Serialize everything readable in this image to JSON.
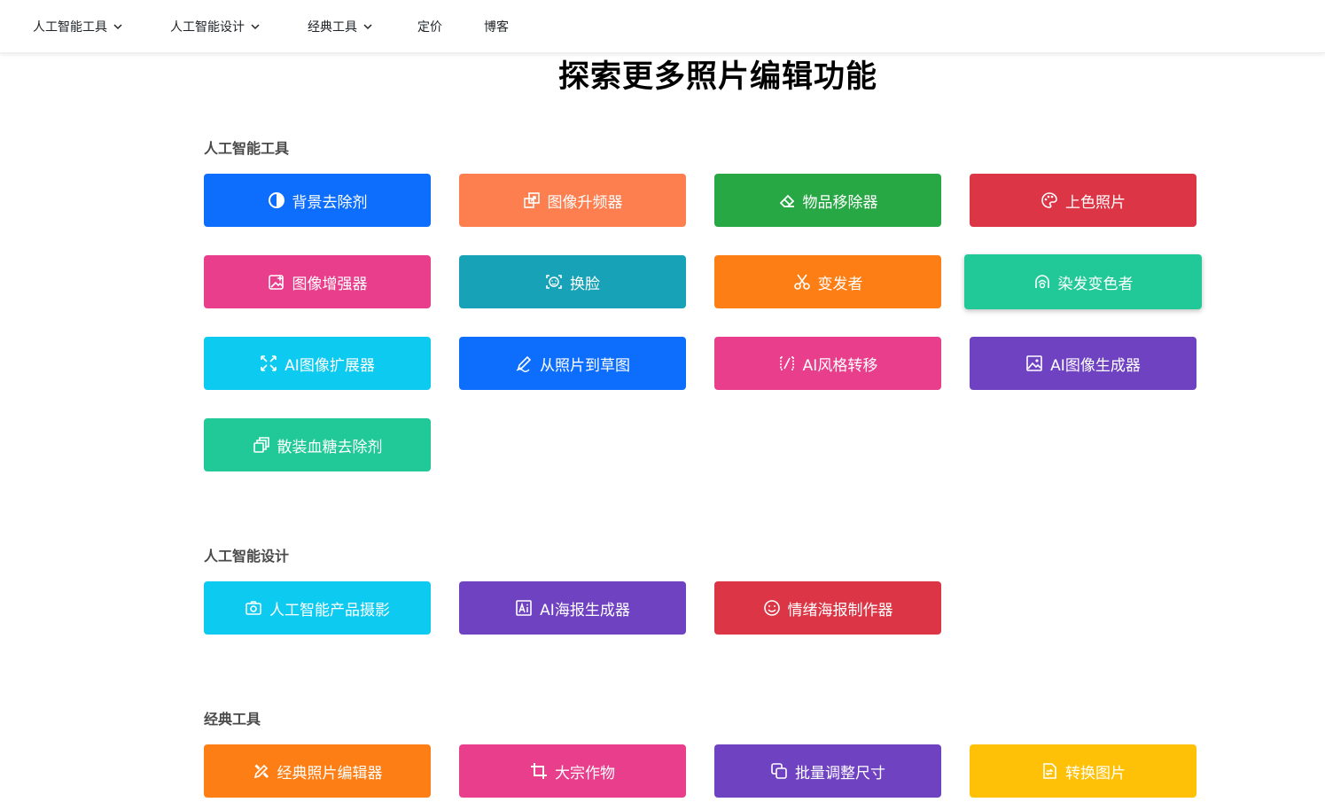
{
  "nav": {
    "items": [
      {
        "label": "人工智能工具",
        "dropdown": true
      },
      {
        "label": "人工智能设计",
        "dropdown": true
      },
      {
        "label": "经典工具",
        "dropdown": true
      },
      {
        "label": "定价",
        "dropdown": false
      },
      {
        "label": "博客",
        "dropdown": false
      }
    ]
  },
  "title": "探索更多照片编辑功能",
  "sections": {
    "ai_tools": {
      "heading": "人工智能工具",
      "buttons": [
        {
          "label": "背景去除剂",
          "icon": "contrast-icon",
          "color": "#0d6efd"
        },
        {
          "label": "图像升频器",
          "icon": "upscale-icon",
          "color": "#fd7e4e"
        },
        {
          "label": "物品移除器",
          "icon": "eraser-icon",
          "color": "#28a745"
        },
        {
          "label": "上色照片",
          "icon": "palette-icon",
          "color": "#dc3545"
        },
        {
          "label": "图像增强器",
          "icon": "image-sparkle-icon",
          "color": "#e83e8c"
        },
        {
          "label": "换脸",
          "icon": "face-scan-icon",
          "color": "#17a2b8"
        },
        {
          "label": "变发者",
          "icon": "scissors-icon",
          "color": "#fd7e14"
        },
        {
          "label": "染发变色者",
          "icon": "hair-icon",
          "color": "#20c997"
        },
        {
          "label": "AI图像扩展器",
          "icon": "expand-icon",
          "color": "#0dcaf0"
        },
        {
          "label": "从照片到草图",
          "icon": "pen-icon",
          "color": "#0d6efd"
        },
        {
          "label": "AI风格转移",
          "icon": "transform-icon",
          "color": "#e83e8c"
        },
        {
          "label": "AI图像生成器",
          "icon": "image-icon",
          "color": "#6f42c1"
        },
        {
          "label": "散装血糖去除剂",
          "icon": "stack-icon",
          "color": "#20c997"
        }
      ]
    },
    "ai_design": {
      "heading": "人工智能设计",
      "buttons": [
        {
          "label": "人工智能产品摄影",
          "icon": "camera-icon",
          "color": "#0dcaf0"
        },
        {
          "label": "AI海报生成器",
          "icon": "ai-text-icon",
          "color": "#6f42c1"
        },
        {
          "label": "情绪海报制作器",
          "icon": "smile-icon",
          "color": "#dc3545"
        }
      ]
    },
    "classic_tools": {
      "heading": "经典工具",
      "buttons": [
        {
          "label": "经典照片编辑器",
          "icon": "tools-icon",
          "color": "#fd7e14"
        },
        {
          "label": "大宗作物",
          "icon": "crop-icon",
          "color": "#e83e8c"
        },
        {
          "label": "批量调整尺寸",
          "icon": "copy-icon",
          "color": "#6f42c1"
        },
        {
          "label": "转换图片",
          "icon": "convert-icon",
          "color": "#ffc107"
        }
      ]
    }
  }
}
